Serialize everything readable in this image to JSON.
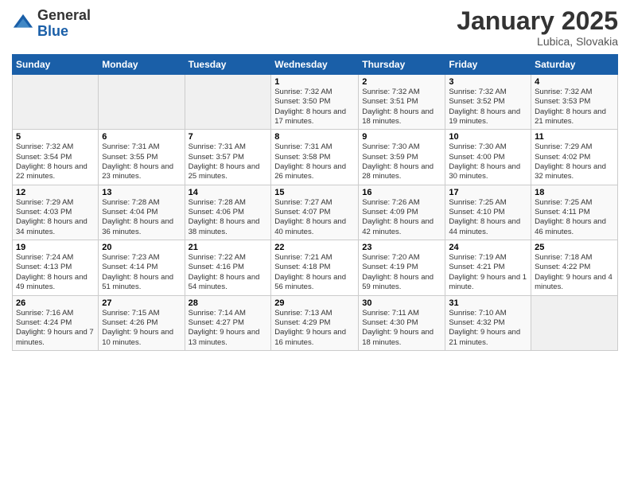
{
  "logo": {
    "general": "General",
    "blue": "Blue"
  },
  "title": "January 2025",
  "location": "Lubica, Slovakia",
  "weekdays": [
    "Sunday",
    "Monday",
    "Tuesday",
    "Wednesday",
    "Thursday",
    "Friday",
    "Saturday"
  ],
  "weeks": [
    [
      {
        "day": "",
        "sunrise": "",
        "sunset": "",
        "daylight": ""
      },
      {
        "day": "",
        "sunrise": "",
        "sunset": "",
        "daylight": ""
      },
      {
        "day": "",
        "sunrise": "",
        "sunset": "",
        "daylight": ""
      },
      {
        "day": "1",
        "sunrise": "Sunrise: 7:32 AM",
        "sunset": "Sunset: 3:50 PM",
        "daylight": "Daylight: 8 hours and 17 minutes."
      },
      {
        "day": "2",
        "sunrise": "Sunrise: 7:32 AM",
        "sunset": "Sunset: 3:51 PM",
        "daylight": "Daylight: 8 hours and 18 minutes."
      },
      {
        "day": "3",
        "sunrise": "Sunrise: 7:32 AM",
        "sunset": "Sunset: 3:52 PM",
        "daylight": "Daylight: 8 hours and 19 minutes."
      },
      {
        "day": "4",
        "sunrise": "Sunrise: 7:32 AM",
        "sunset": "Sunset: 3:53 PM",
        "daylight": "Daylight: 8 hours and 21 minutes."
      }
    ],
    [
      {
        "day": "5",
        "sunrise": "Sunrise: 7:32 AM",
        "sunset": "Sunset: 3:54 PM",
        "daylight": "Daylight: 8 hours and 22 minutes."
      },
      {
        "day": "6",
        "sunrise": "Sunrise: 7:31 AM",
        "sunset": "Sunset: 3:55 PM",
        "daylight": "Daylight: 8 hours and 23 minutes."
      },
      {
        "day": "7",
        "sunrise": "Sunrise: 7:31 AM",
        "sunset": "Sunset: 3:57 PM",
        "daylight": "Daylight: 8 hours and 25 minutes."
      },
      {
        "day": "8",
        "sunrise": "Sunrise: 7:31 AM",
        "sunset": "Sunset: 3:58 PM",
        "daylight": "Daylight: 8 hours and 26 minutes."
      },
      {
        "day": "9",
        "sunrise": "Sunrise: 7:30 AM",
        "sunset": "Sunset: 3:59 PM",
        "daylight": "Daylight: 8 hours and 28 minutes."
      },
      {
        "day": "10",
        "sunrise": "Sunrise: 7:30 AM",
        "sunset": "Sunset: 4:00 PM",
        "daylight": "Daylight: 8 hours and 30 minutes."
      },
      {
        "day": "11",
        "sunrise": "Sunrise: 7:29 AM",
        "sunset": "Sunset: 4:02 PM",
        "daylight": "Daylight: 8 hours and 32 minutes."
      }
    ],
    [
      {
        "day": "12",
        "sunrise": "Sunrise: 7:29 AM",
        "sunset": "Sunset: 4:03 PM",
        "daylight": "Daylight: 8 hours and 34 minutes."
      },
      {
        "day": "13",
        "sunrise": "Sunrise: 7:28 AM",
        "sunset": "Sunset: 4:04 PM",
        "daylight": "Daylight: 8 hours and 36 minutes."
      },
      {
        "day": "14",
        "sunrise": "Sunrise: 7:28 AM",
        "sunset": "Sunset: 4:06 PM",
        "daylight": "Daylight: 8 hours and 38 minutes."
      },
      {
        "day": "15",
        "sunrise": "Sunrise: 7:27 AM",
        "sunset": "Sunset: 4:07 PM",
        "daylight": "Daylight: 8 hours and 40 minutes."
      },
      {
        "day": "16",
        "sunrise": "Sunrise: 7:26 AM",
        "sunset": "Sunset: 4:09 PM",
        "daylight": "Daylight: 8 hours and 42 minutes."
      },
      {
        "day": "17",
        "sunrise": "Sunrise: 7:25 AM",
        "sunset": "Sunset: 4:10 PM",
        "daylight": "Daylight: 8 hours and 44 minutes."
      },
      {
        "day": "18",
        "sunrise": "Sunrise: 7:25 AM",
        "sunset": "Sunset: 4:11 PM",
        "daylight": "Daylight: 8 hours and 46 minutes."
      }
    ],
    [
      {
        "day": "19",
        "sunrise": "Sunrise: 7:24 AM",
        "sunset": "Sunset: 4:13 PM",
        "daylight": "Daylight: 8 hours and 49 minutes."
      },
      {
        "day": "20",
        "sunrise": "Sunrise: 7:23 AM",
        "sunset": "Sunset: 4:14 PM",
        "daylight": "Daylight: 8 hours and 51 minutes."
      },
      {
        "day": "21",
        "sunrise": "Sunrise: 7:22 AM",
        "sunset": "Sunset: 4:16 PM",
        "daylight": "Daylight: 8 hours and 54 minutes."
      },
      {
        "day": "22",
        "sunrise": "Sunrise: 7:21 AM",
        "sunset": "Sunset: 4:18 PM",
        "daylight": "Daylight: 8 hours and 56 minutes."
      },
      {
        "day": "23",
        "sunrise": "Sunrise: 7:20 AM",
        "sunset": "Sunset: 4:19 PM",
        "daylight": "Daylight: 8 hours and 59 minutes."
      },
      {
        "day": "24",
        "sunrise": "Sunrise: 7:19 AM",
        "sunset": "Sunset: 4:21 PM",
        "daylight": "Daylight: 9 hours and 1 minute."
      },
      {
        "day": "25",
        "sunrise": "Sunrise: 7:18 AM",
        "sunset": "Sunset: 4:22 PM",
        "daylight": "Daylight: 9 hours and 4 minutes."
      }
    ],
    [
      {
        "day": "26",
        "sunrise": "Sunrise: 7:16 AM",
        "sunset": "Sunset: 4:24 PM",
        "daylight": "Daylight: 9 hours and 7 minutes."
      },
      {
        "day": "27",
        "sunrise": "Sunrise: 7:15 AM",
        "sunset": "Sunset: 4:26 PM",
        "daylight": "Daylight: 9 hours and 10 minutes."
      },
      {
        "day": "28",
        "sunrise": "Sunrise: 7:14 AM",
        "sunset": "Sunset: 4:27 PM",
        "daylight": "Daylight: 9 hours and 13 minutes."
      },
      {
        "day": "29",
        "sunrise": "Sunrise: 7:13 AM",
        "sunset": "Sunset: 4:29 PM",
        "daylight": "Daylight: 9 hours and 16 minutes."
      },
      {
        "day": "30",
        "sunrise": "Sunrise: 7:11 AM",
        "sunset": "Sunset: 4:30 PM",
        "daylight": "Daylight: 9 hours and 18 minutes."
      },
      {
        "day": "31",
        "sunrise": "Sunrise: 7:10 AM",
        "sunset": "Sunset: 4:32 PM",
        "daylight": "Daylight: 9 hours and 21 minutes."
      },
      {
        "day": "",
        "sunrise": "",
        "sunset": "",
        "daylight": ""
      }
    ]
  ]
}
